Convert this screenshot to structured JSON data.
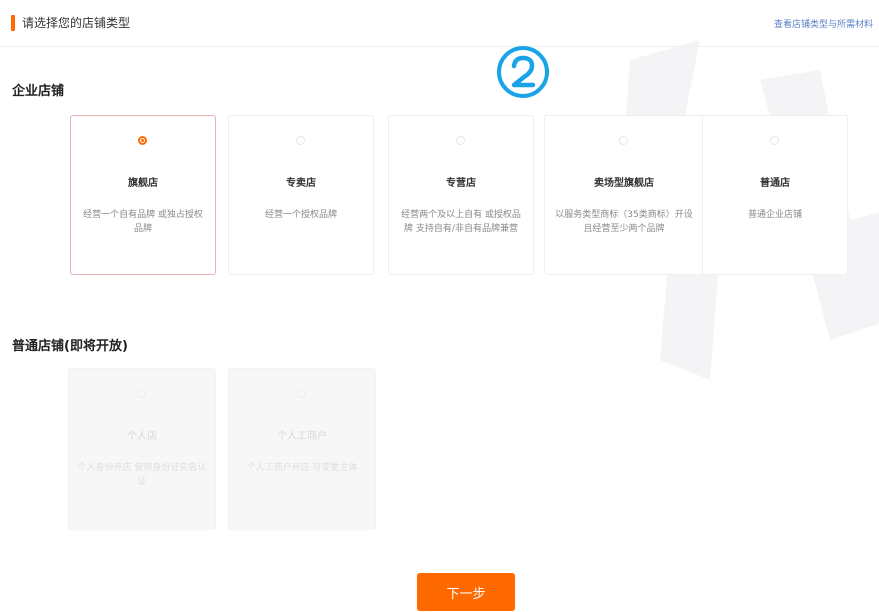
{
  "header": {
    "title": "请选择您的店铺类型",
    "link": "查看店铺类型与所需材料"
  },
  "step_badge": "②",
  "enterprise": {
    "title": "企业店铺",
    "cards": [
      {
        "name": "旗舰店",
        "desc": "经营一个自有品牌 或独占授权品牌",
        "selected": true
      },
      {
        "name": "专卖店",
        "desc": "经营一个授权品牌",
        "selected": false
      },
      {
        "name": "专营店",
        "desc": "经营两个及以上自有 或授权品牌 支持自有/非自有品牌兼营",
        "selected": false
      },
      {
        "name": "卖场型旗舰店",
        "desc": "以服务类型商标（35类商标）开设且经营至少两个品牌",
        "selected": false
      },
      {
        "name": "普通店",
        "desc": "普通企业店铺",
        "selected": false
      }
    ]
  },
  "normal": {
    "title": "普通店铺(即将开放)",
    "cards": [
      {
        "name": "个人店",
        "desc": "个人身份开店 使用身份证实名认证"
      },
      {
        "name": "个人工商户",
        "desc": "个人工商户开店 可变更主体"
      }
    ]
  },
  "next_button": "下一步",
  "colors": {
    "accent": "#ff6a00",
    "link": "#5a7fc4",
    "selected_border": "#e8b2b2"
  }
}
